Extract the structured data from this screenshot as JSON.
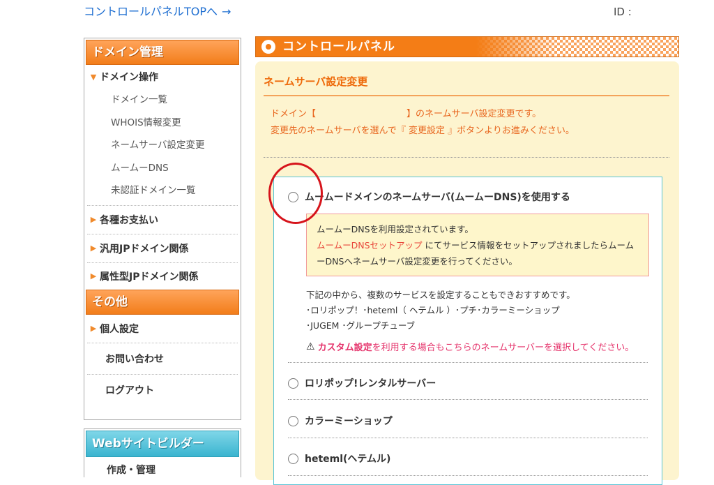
{
  "header": {
    "top_link": "コントロールパネルTOPへ",
    "top_link_arrow": "→",
    "id_label": "ID :"
  },
  "sidebar": {
    "domain_header": "ドメイン管理",
    "domain_ops": "ドメイン操作",
    "domain_ops_children": [
      "ドメイン一覧",
      "WHOIS情報変更",
      "ネームサーバ設定変更",
      "ムームーDNS",
      "未認証ドメイン一覧"
    ],
    "payments": "各種お支払い",
    "jp_general": "汎用JPドメイン関係",
    "jp_attr": "属性型JPドメイン関係",
    "other_header": "その他",
    "personal": "個人設定",
    "contact": "お問い合わせ",
    "logout": "ログアウト",
    "builder_header": "Webサイトビルダー",
    "builder_item": "作成・管理"
  },
  "panel": {
    "title": "コントロールパネル",
    "section_title": "ネームサーバ設定変更",
    "desc_line1": "ドメイン【　　　　　　　　　　】のネームサーバ設定変更です。",
    "desc_line2": "変更先のネームサーバを選んで『 変更設定 』ボタンよりお進みください。"
  },
  "options": {
    "muumuu": "ムームードメインのネームサーバ(ムームーDNS)を使用する",
    "notice_line1": "ムームーDNSを利用設定されています。",
    "notice_link": "ムームーDNSセットアップ",
    "notice_line2_rest": " にてサービス情報をセットアップされましたらムーム",
    "notice_line3": "ーDNSへネームサーバ設定変更を行ってください。",
    "info_line1": "下記の中から、複数のサービスを設定することもできおすすめです。",
    "info_line2": "･ロリポップ！･heteml（ ヘテムル ）･プチ･カラーミーショップ",
    "info_line3": "･JUGEM ･グループチューブ",
    "warn_icon": "warning-icon",
    "warn_bold": "カスタム設定",
    "warn_rest": "を利用する場合もこちらのネームサーバーを選択してください。",
    "lolipop": "ロリポップ!レンタルサーバー",
    "colorme": "カラーミーショップ",
    "heteml": "heteml(ヘテムル)"
  },
  "colors": {
    "accent_orange": "#f47d16",
    "link_blue": "#1f6fd1",
    "teal_border": "#57c4d6",
    "annotation_red": "#d6141b"
  }
}
